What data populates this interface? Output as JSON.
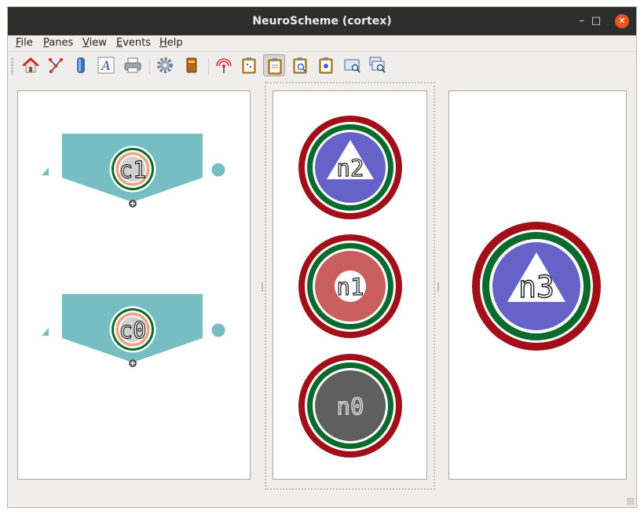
{
  "window": {
    "title": "NeuroScheme (cortex)",
    "controls": {
      "minimize": "–",
      "maximize": "□",
      "close": "✕"
    }
  },
  "menubar": {
    "items": [
      {
        "mnemonic": "F",
        "rest": "ile"
      },
      {
        "mnemonic": "P",
        "rest": "anes"
      },
      {
        "mnemonic": "V",
        "rest": "iew"
      },
      {
        "mnemonic": "E",
        "rest": "vents"
      },
      {
        "mnemonic": "H",
        "rest": "elp"
      }
    ]
  },
  "toolbar": {
    "buttons": [
      {
        "icon": "home-icon",
        "active": false
      },
      {
        "icon": "connectivity-icon",
        "active": true
      },
      {
        "icon": "layout-icon",
        "active": true
      },
      {
        "icon": "text-icon",
        "active": true
      },
      {
        "icon": "printer-icon",
        "active": false
      },
      {
        "icon": "settings-gear-icon",
        "active": false
      },
      {
        "icon": "book-icon",
        "active": false
      },
      {
        "icon": "broadcast-icon",
        "active": false
      },
      {
        "icon": "clipboard-icon",
        "active": false
      },
      {
        "icon": "clipboard-check-icon",
        "active": true
      },
      {
        "icon": "clipboard-search-icon",
        "active": false
      },
      {
        "icon": "clipboard-list-icon",
        "active": false
      },
      {
        "icon": "screen-zoom-icon",
        "active": false
      },
      {
        "icon": "screen-zoom-multi-icon",
        "active": false
      }
    ]
  },
  "colors": {
    "column_shape": "#76bec4",
    "ring_outer": "#a10f18",
    "ring_inner": "#0a6b2d",
    "pyramidal_fill": "#6562c8",
    "interneuron_fill": "#c85f5e",
    "unknown_fill": "#5f5f5f",
    "column_label_bg": "#d1d1d1",
    "column_ring_salmon": "#f2a07e"
  },
  "panes": {
    "left": {
      "columns": [
        {
          "label": "c1"
        },
        {
          "label": "c0"
        }
      ]
    },
    "middle": {
      "neurons": [
        {
          "label": "n2",
          "type": "pyramidal"
        },
        {
          "label": "n1",
          "type": "interneuron"
        },
        {
          "label": "n0",
          "type": "unknown"
        }
      ]
    },
    "right": {
      "neurons": [
        {
          "label": "n3",
          "type": "pyramidal"
        }
      ]
    }
  }
}
